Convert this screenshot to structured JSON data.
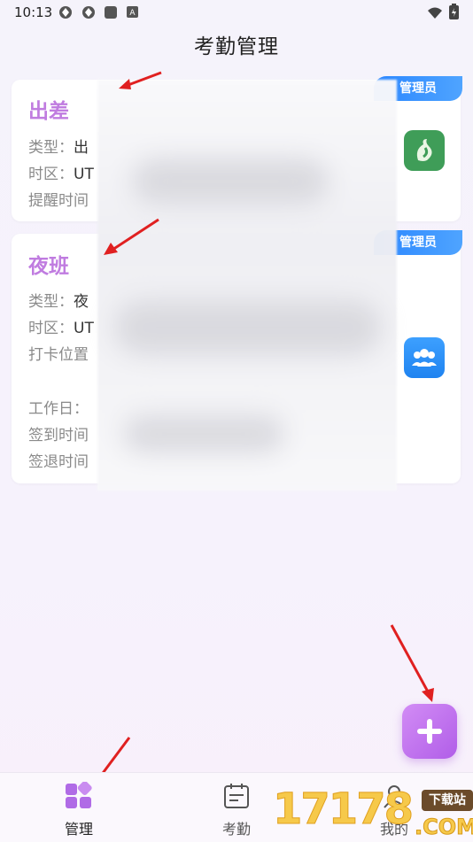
{
  "status_bar": {
    "time": "10:13"
  },
  "header": {
    "title": "考勤管理"
  },
  "cards": [
    {
      "title": "出差",
      "badge": "管理员",
      "fields": [
        {
          "label": "类型：",
          "value": "出"
        },
        {
          "label": "时区：",
          "value": "UT"
        },
        {
          "label": "提醒时间",
          "value": ""
        }
      ]
    },
    {
      "title": "夜班",
      "badge": "管理员",
      "fields": [
        {
          "label": "类型：",
          "value": "夜"
        },
        {
          "label": "时区：",
          "value": "UT"
        },
        {
          "label": "打卡位置",
          "value": ""
        },
        {
          "label": "工作日：",
          "value": ""
        },
        {
          "label": "签到时间",
          "value": ""
        },
        {
          "label": "签退时间",
          "value": ""
        }
      ]
    }
  ],
  "tabs": [
    {
      "label": "管理",
      "icon": "grid-icon",
      "active": true
    },
    {
      "label": "考勤",
      "icon": "calendar-icon",
      "active": false
    },
    {
      "label": "我的",
      "icon": "user-icon",
      "active": false
    }
  ],
  "watermark": {
    "number": "17178",
    "tag": "下载站",
    "domain": ".COM"
  },
  "colors": {
    "accent": "#c07ce0",
    "badge": "#2a86ff",
    "fab": "#c27aef",
    "annotation_arrow": "#e02020"
  }
}
